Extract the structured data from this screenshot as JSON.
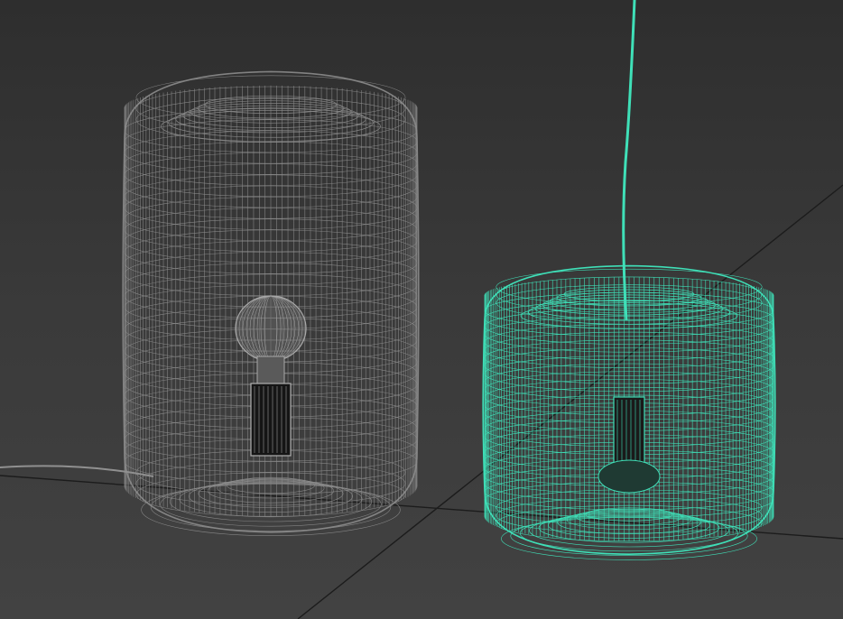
{
  "viewport": {
    "background_color": "#3a3a3a",
    "grid_line_color": "#1c1c1c"
  },
  "objects": [
    {
      "name": "table-lamp-left",
      "kind": "table lamp wireframe",
      "wire_color": "#8c8c8c",
      "selected": false,
      "parts": [
        "glass-shade",
        "bulb",
        "socket",
        "base",
        "power-cord"
      ]
    },
    {
      "name": "pendant-lamp-right",
      "kind": "pendant lamp wireframe",
      "wire_color": "#3fe0b8",
      "selected": true,
      "parts": [
        "glass-shade",
        "socket",
        "hanging-cord"
      ]
    }
  ]
}
